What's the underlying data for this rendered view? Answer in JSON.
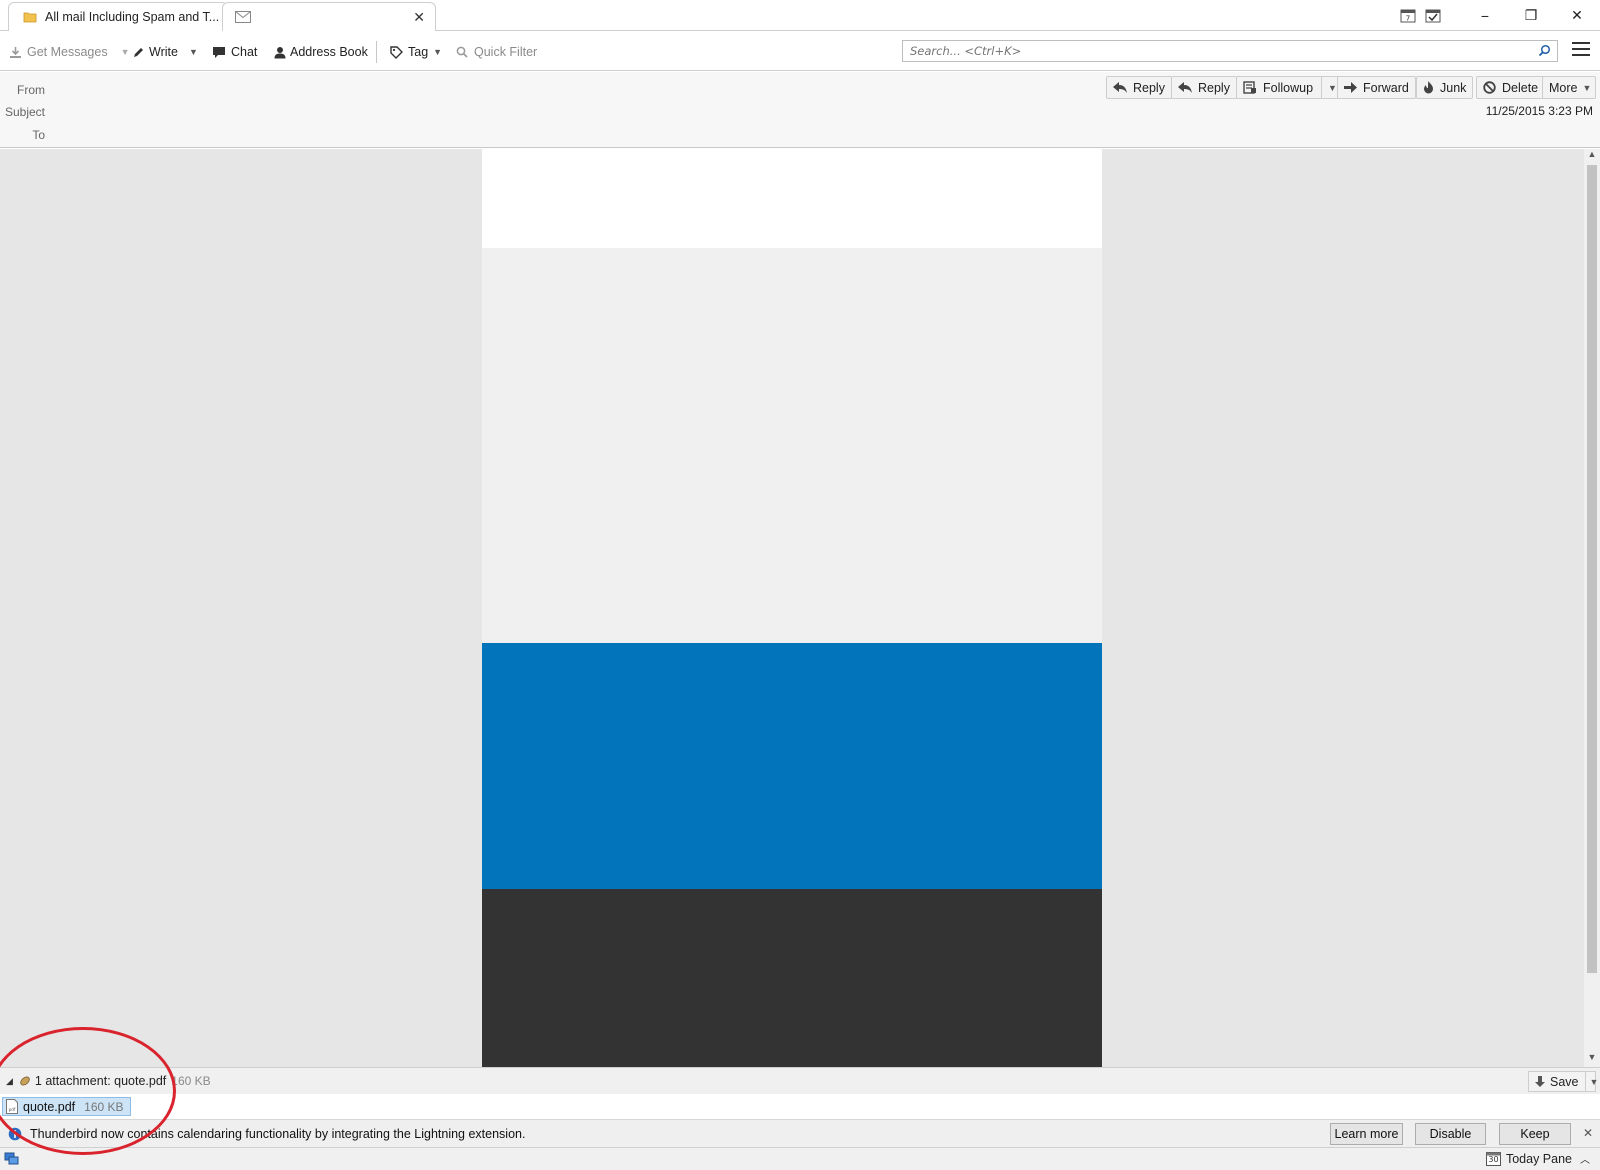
{
  "tabs": [
    {
      "label": "All mail Including Spam and T...",
      "icon": "folder-icon"
    },
    {
      "label": "",
      "icon": "envelope-icon"
    }
  ],
  "window_controls": {
    "minimize": "−",
    "restore": "❐",
    "close": "✕"
  },
  "toolbar": {
    "get_messages": "Get Messages",
    "write": "Write",
    "chat": "Chat",
    "address_book": "Address Book",
    "tag": "Tag",
    "quick_filter": "Quick Filter"
  },
  "search": {
    "placeholder": "Search... <Ctrl+K>"
  },
  "header": {
    "labels": {
      "from": "From",
      "subject": "Subject",
      "to": "To"
    },
    "buttons": {
      "reply": "Reply",
      "reply_all": "Reply",
      "followup": "Followup",
      "forward": "Forward",
      "junk": "Junk",
      "delete": "Delete",
      "more": "More"
    },
    "date": "11/25/2015 3:23 PM"
  },
  "body": {
    "colors": {
      "white": "#ffffff",
      "gray": "#f0f0f0",
      "blue": "#0174bc",
      "dark": "#333333",
      "backdrop": "#e6e6e6"
    }
  },
  "attachments": {
    "summary": "1 attachment: quote.pdf",
    "summary_size": "160 KB",
    "save_label": "Save",
    "items": [
      {
        "name": "quote.pdf",
        "size": "160 KB"
      }
    ]
  },
  "notification": {
    "message": "Thunderbird now contains calendaring functionality by integrating the Lightning extension.",
    "learn_more": "Learn more",
    "disable": "Disable",
    "keep": "Keep",
    "close": "✕"
  },
  "statusbar": {
    "today_pane": "Today Pane",
    "calendar_day": "30"
  },
  "annotation": {
    "color": "#d9232d"
  }
}
